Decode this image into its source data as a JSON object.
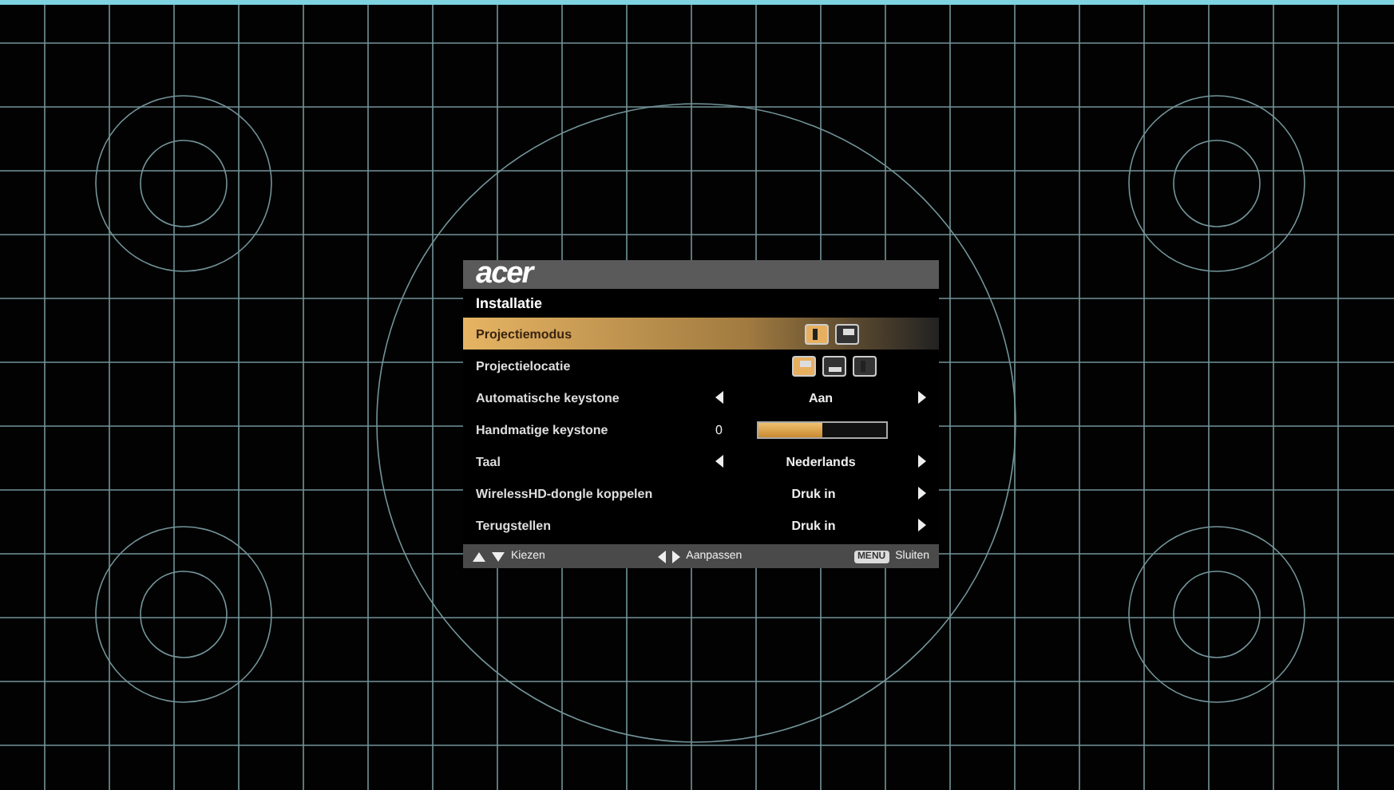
{
  "menu": {
    "logo": "acer",
    "title": "Installatie",
    "rows": [
      {
        "kind": "icons",
        "label": "Projectiemodus",
        "selected": true,
        "options": [
          {
            "selected": true
          },
          {
            "selected": false
          }
        ]
      },
      {
        "kind": "icons",
        "label": "Projectielocatie",
        "selected": false,
        "options": [
          {
            "selected": true
          },
          {
            "selected": false
          },
          {
            "selected": false
          }
        ]
      },
      {
        "kind": "choice",
        "label": "Automatische keystone",
        "selected": false,
        "value": "Aan"
      },
      {
        "kind": "slider",
        "label": "Handmatige keystone",
        "selected": false,
        "value": "0",
        "level": 0.5
      },
      {
        "kind": "choice",
        "label": "Taal",
        "selected": false,
        "value": "Nederlands"
      },
      {
        "kind": "action",
        "label": "WirelessHD-dongle koppelen",
        "selected": false,
        "value": "Druk in"
      },
      {
        "kind": "action",
        "label": "Terugstellen",
        "selected": false,
        "value": "Druk in"
      }
    ],
    "footer": {
      "select": "Kiezen",
      "adjust": "Aanpassen",
      "menu_key": "MENU",
      "close": "Sluiten"
    }
  }
}
